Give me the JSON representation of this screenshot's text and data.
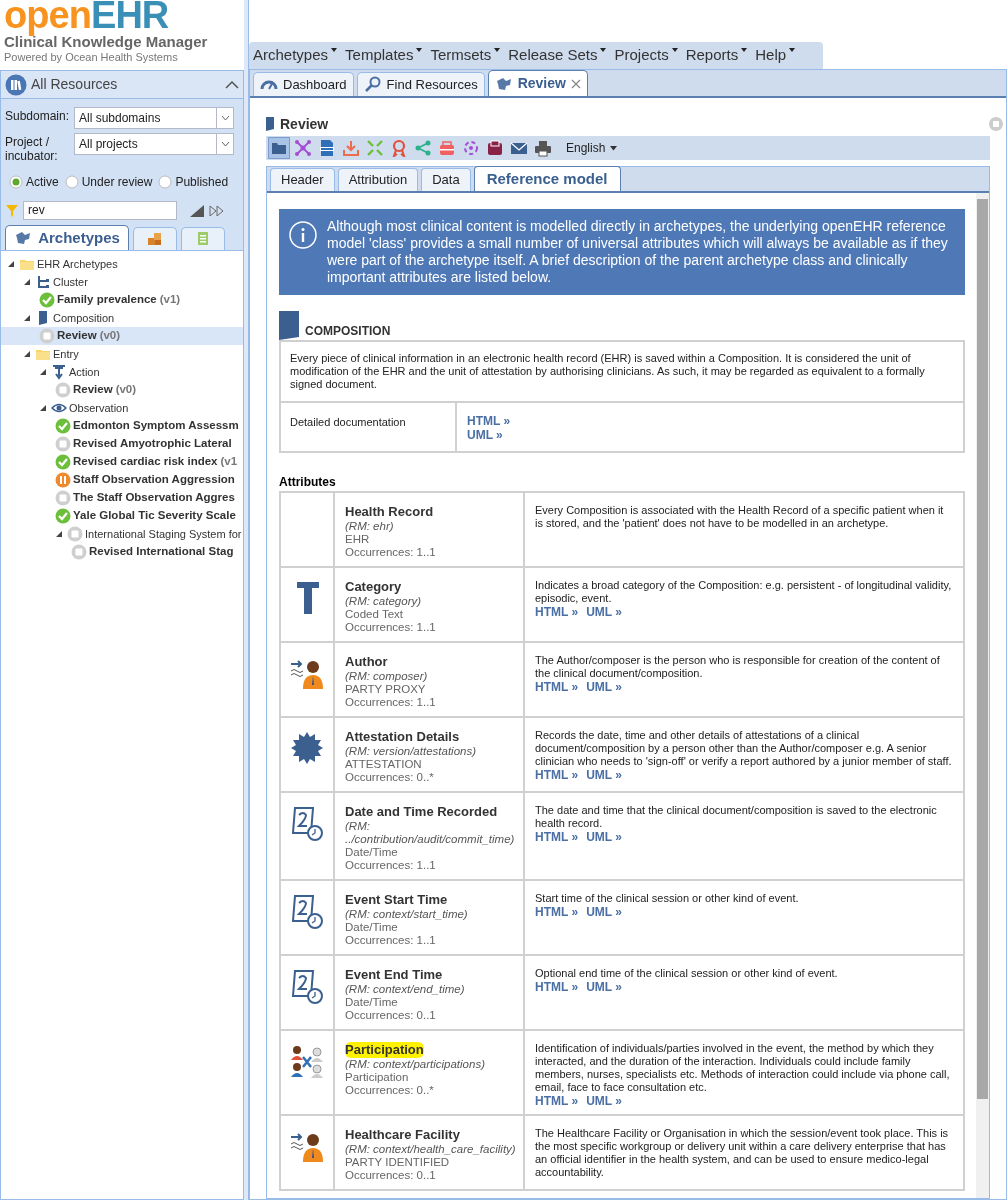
{
  "logo": {
    "brand_a": "open",
    "brand_b": "EHR",
    "title": "Clinical Knowledge Manager",
    "subtitle": "Powered by Ocean Health Systems"
  },
  "sidebar": {
    "header": "All Resources",
    "filters": [
      {
        "label": "Subdomain:",
        "value": "All subdomains"
      },
      {
        "label": "Project / incubator:",
        "value": "All projects"
      }
    ],
    "status_options": [
      {
        "label": "Active",
        "selected": true
      },
      {
        "label": "Under review",
        "selected": false
      },
      {
        "label": "Published",
        "selected": false
      }
    ],
    "search": {
      "value": "rev"
    },
    "tabs": [
      {
        "kind": "archetype",
        "label": "Archetypes",
        "selected": true
      },
      {
        "kind": "template",
        "selected": false
      },
      {
        "kind": "termset",
        "selected": false
      }
    ],
    "tree": [
      {
        "kind": "folder",
        "label": "EHR Archetypes",
        "expanded": true,
        "children": [
          {
            "kind": "cluster",
            "label": "Cluster",
            "expanded": true,
            "children": [
              {
                "kind": "approved",
                "label": "Family prevalence",
                "version": "(v1)",
                "selected": false
              }
            ]
          },
          {
            "kind": "composition",
            "label": "Composition",
            "expanded": true,
            "children": [
              {
                "kind": "draft",
                "label": "Review",
                "version": "(v0)",
                "selected": true
              }
            ]
          },
          {
            "kind": "folder",
            "label": "Entry",
            "expanded": true,
            "children": [
              {
                "kind": "action",
                "label": "Action",
                "expanded": true,
                "children": [
                  {
                    "kind": "draft",
                    "label": "Review",
                    "version": "(v0)",
                    "selected": false
                  }
                ]
              },
              {
                "kind": "observation",
                "label": "Observation",
                "expanded": true,
                "children": [
                  {
                    "kind": "approved",
                    "label": "Edmonton Symptom Assessm",
                    "selected": false
                  },
                  {
                    "kind": "draft",
                    "label": "Revised Amyotrophic Lateral",
                    "selected": false
                  },
                  {
                    "kind": "approved",
                    "label": "Revised cardiac risk index",
                    "version": "(v1",
                    "selected": false
                  },
                  {
                    "kind": "review",
                    "label": "Staff Observation Aggression",
                    "selected": false
                  },
                  {
                    "kind": "draft",
                    "label": "The Staff Observation Aggres",
                    "selected": false
                  },
                  {
                    "kind": "approved",
                    "label": "Yale Global Tic Severity Scale",
                    "selected": false
                  },
                  {
                    "kind": "group",
                    "label": "International Staging System for",
                    "expanded": true,
                    "children": [
                      {
                        "kind": "draft",
                        "label": "Revised International Stag",
                        "selected": false
                      }
                    ]
                  }
                ]
              }
            ]
          }
        ]
      }
    ]
  },
  "menu": [
    "Archetypes",
    "Templates",
    "Termsets",
    "Release Sets",
    "Projects",
    "Reports",
    "Help"
  ],
  "tabs": [
    {
      "kind": "dashboard",
      "label": "Dashboard",
      "selected": false,
      "closable": false
    },
    {
      "kind": "search",
      "label": "Find Resources",
      "selected": false,
      "closable": false
    },
    {
      "kind": "archetype",
      "label": "Review",
      "selected": true,
      "closable": true
    }
  ],
  "panel": {
    "title": "Review",
    "toolbar": [
      {
        "kind": "folder",
        "selected": true
      },
      {
        "kind": "mindmap",
        "selected": false
      },
      {
        "kind": "adl",
        "selected": false
      },
      {
        "kind": "export",
        "selected": false
      },
      {
        "kind": "compress",
        "selected": false
      },
      {
        "kind": "award",
        "selected": false
      },
      {
        "kind": "share",
        "selected": false
      },
      {
        "kind": "printer",
        "selected": false
      },
      {
        "kind": "spinner",
        "selected": false
      },
      {
        "kind": "archive",
        "selected": false
      },
      {
        "kind": "mail",
        "selected": false
      },
      {
        "kind": "print",
        "selected": false
      }
    ],
    "language": "English",
    "subtabs": [
      {
        "label": "Header",
        "selected": false
      },
      {
        "label": "Attribution",
        "selected": false
      },
      {
        "label": "Data",
        "selected": false
      },
      {
        "label": "Reference model",
        "selected": true
      }
    ],
    "info": "Although most clinical content is modelled directly in archetypes, the underlying openEHR reference model 'class' provides a small number of universal attributes which will always be available as if they were part of the archetype itself. A brief description of the parent archetype class and clinically important attributes are listed below.",
    "section": {
      "title": "COMPOSITION",
      "description": "Every piece of clinical information in an electronic health record (EHR) is saved within a Composition. It is considered the unit of modification of the EHR and the unit of attestation by authorising clinicians. As such, it may be regarded as equivalent to a formally signed document.",
      "doc_label": "Detailed documentation",
      "links": [
        "HTML »",
        "UML »"
      ]
    },
    "attributes_heading": "Attributes",
    "attributes": [
      {
        "kind": "none",
        "name": "Health Record",
        "rm": "(RM: ehr)",
        "type": "EHR",
        "occurrences": "Occurrences: 1..1",
        "description": "Every Composition is associated with the Health Record of a specific patient when it is stored, and the 'patient' does not have to be modelled in an archetype.",
        "highlighted": false
      },
      {
        "kind": "coded-text",
        "name": "Category",
        "rm": "(RM: category)",
        "type": "Coded Text",
        "occurrences": "Occurrences: 1..1",
        "description": "Indicates a broad category of the Composition: e.g. persistent - of longitudinal validity, episodic, event.",
        "links": [
          "HTML »",
          "UML »"
        ],
        "highlighted": false
      },
      {
        "kind": "person",
        "name": "Author",
        "rm": "(RM: composer)",
        "type": "PARTY PROXY",
        "occurrences": "Occurrences: 1..1",
        "description": "The Author/composer is the person who is responsible for creation of the content of the clinical document/composition.",
        "links": [
          "HTML »",
          "UML »"
        ],
        "highlighted": false
      },
      {
        "kind": "seal",
        "name": "Attestation Details",
        "rm": "(RM: version/attestations)",
        "type": "ATTESTATION",
        "occurrences": "Occurrences: 0..*",
        "description": "Records the date, time and other details of attestations of a clinical document/composition by a person other than the Author/composer e.g. A senior clinician who needs to 'sign-off' or verify a report authored by a junior member of staff.",
        "links": [
          "HTML »",
          "UML »"
        ],
        "highlighted": false
      },
      {
        "kind": "datetime",
        "name": "Date and Time Recorded",
        "rm": "(RM: ../contribution/audit/commit_time)",
        "type": "Date/Time",
        "occurrences": "Occurrences: 1..1",
        "description": "The date and time that the clinical document/composition is saved to the electronic health record.",
        "links": [
          "HTML »",
          "UML »"
        ],
        "highlighted": false
      },
      {
        "kind": "datetime",
        "name": "Event Start Time",
        "rm": "(RM: context/start_time)",
        "type": "Date/Time",
        "occurrences": "Occurrences: 1..1",
        "description": "Start time of the clinical session or other kind of event.",
        "links": [
          "HTML »",
          "UML »"
        ],
        "highlighted": false
      },
      {
        "kind": "datetime",
        "name": "Event End Time",
        "rm": "(RM: context/end_time)",
        "type": "Date/Time",
        "occurrences": "Occurrences: 0..1",
        "description": "Optional end time of the clinical session or other kind of event.",
        "links": [
          "HTML »",
          "UML »"
        ],
        "highlighted": false
      },
      {
        "kind": "group",
        "name": "Participation",
        "rm": "(RM: context/participations)",
        "type": "Participation",
        "occurrences": "Occurrences: 0..*",
        "description": "Identification of individuals/parties involved in the event, the method by which they interacted, and the duration of the interaction. Individuals could include family members, nurses, specialists etc. Methods of interaction could include via phone call, email, face to face consultation etc.",
        "links": [
          "HTML »",
          "UML »"
        ],
        "highlighted": true
      },
      {
        "kind": "person",
        "name": "Healthcare Facility",
        "rm": "(RM: context/health_care_facility)",
        "type": "PARTY IDENTIFIED",
        "occurrences": "Occurrences: 0..1",
        "description": "The Healthcare Facility or Organisation in which the session/event took place. This is the most specific workgroup or delivery unit within a care delivery enterprise that has an official identifier in the health system, and can be used to ensure medico-legal accountability.",
        "highlighted": false
      }
    ]
  }
}
